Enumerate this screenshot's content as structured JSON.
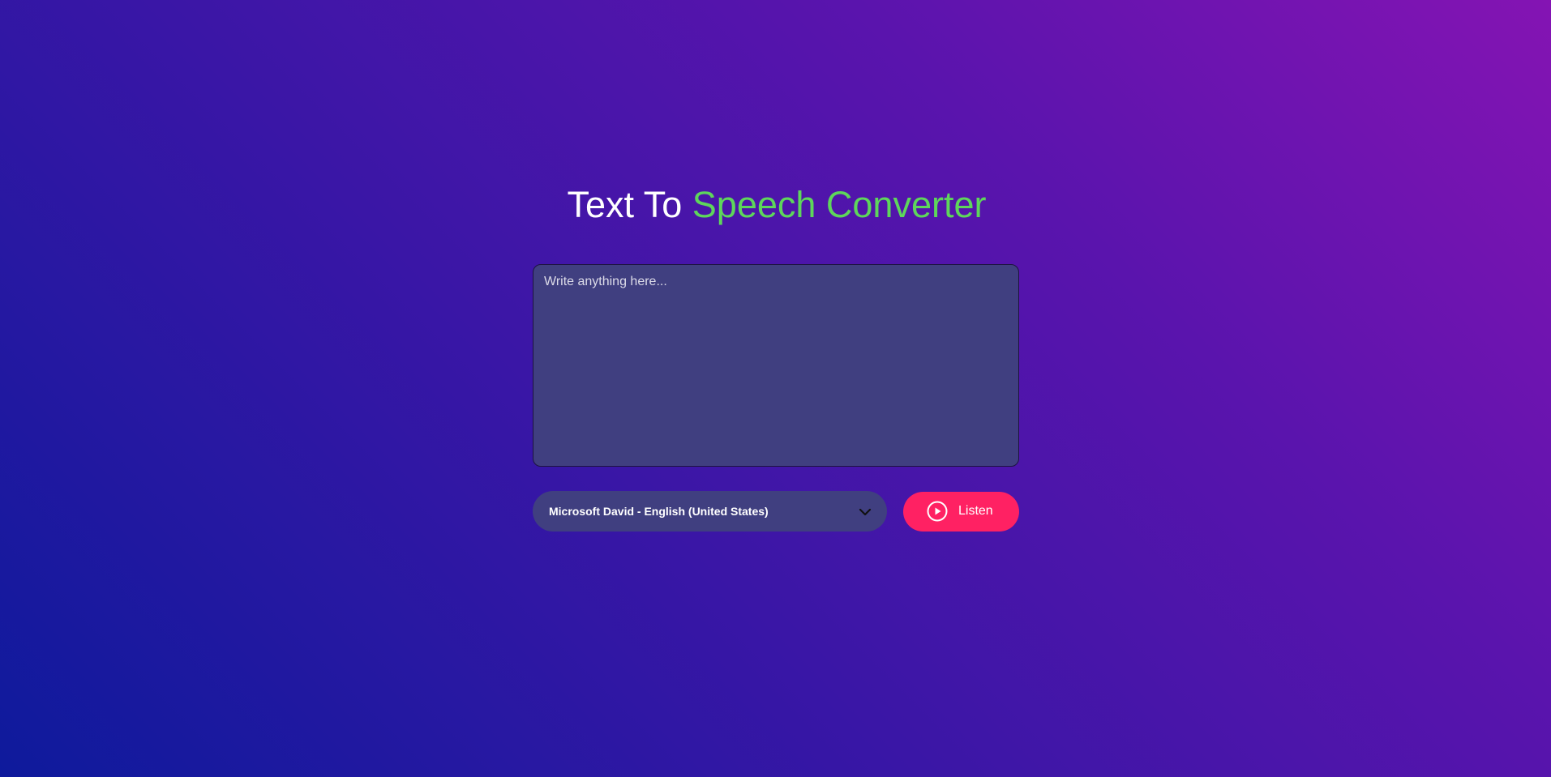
{
  "header": {
    "title_prefix": "Text To",
    "title_accent": "Speech Converter"
  },
  "editor": {
    "placeholder": "Write anything here...",
    "value": ""
  },
  "voice_select": {
    "selected": "Microsoft David - English (United States)",
    "icon": "chevron-down-icon"
  },
  "listen_button": {
    "label": "Listen",
    "icon": "play-circle-icon"
  },
  "colors": {
    "accent": "#5ed65b",
    "button": "#ff2163",
    "panel": "#403f80"
  }
}
